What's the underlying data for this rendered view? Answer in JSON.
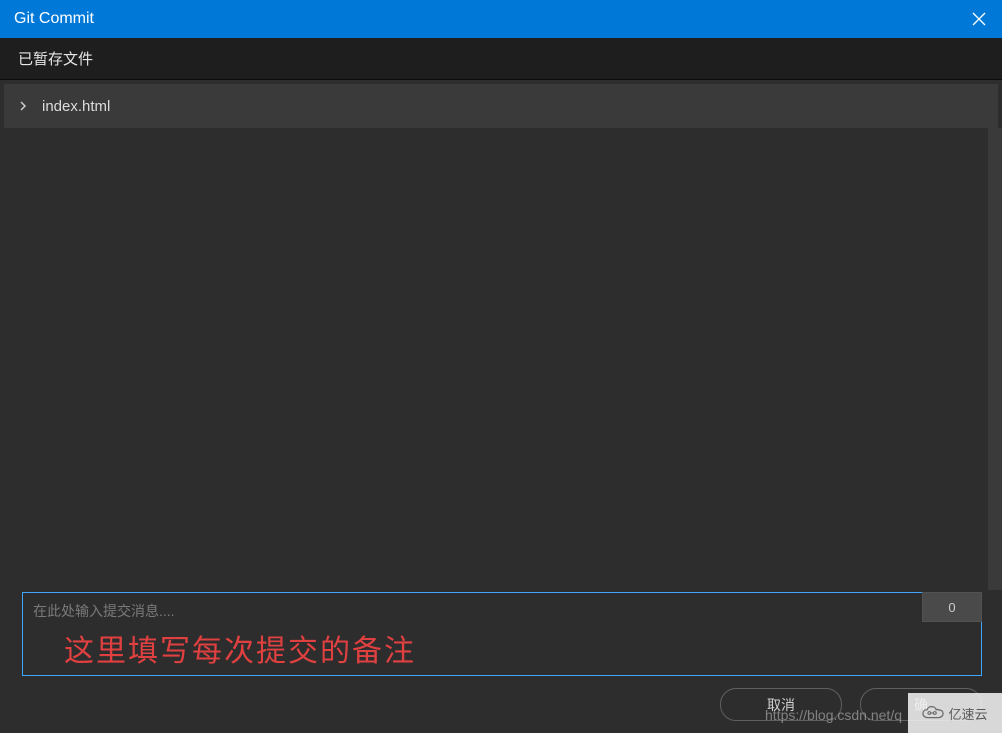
{
  "titlebar": {
    "title": "Git Commit"
  },
  "section": {
    "staged_header": "已暂存文件"
  },
  "files": {
    "items": [
      {
        "name": "index.html"
      }
    ]
  },
  "commit": {
    "placeholder": "在此处输入提交消息....",
    "char_count": "0",
    "value": ""
  },
  "annotation": {
    "text": "这里填写每次提交的备注"
  },
  "footer": {
    "cancel_label": "取消",
    "confirm_label": "确"
  },
  "watermark": {
    "url": "https://blog.csdn.net/q",
    "brand": "亿速云"
  }
}
